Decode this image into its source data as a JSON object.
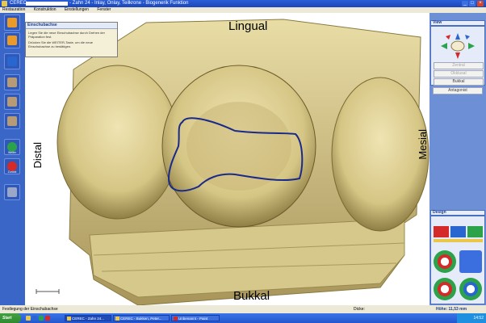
{
  "window": {
    "app_name": "CEREC",
    "title_rest": "- Zahn 24 - Inlay, Onlay, Teilkrone - Biogenerik Funktion"
  },
  "menu": [
    "Restauration",
    "Konstruktion",
    "Einstellungen",
    "Fenster"
  ],
  "toolbar": {
    "buttons": [
      {
        "name": "new-button",
        "label": "",
        "color": "#e89a2a"
      },
      {
        "name": "save-button",
        "label": "",
        "color": "#2a66d0"
      },
      {
        "name": "tool-1-button",
        "label": "",
        "color": "#b79b76"
      },
      {
        "name": "tool-2-button",
        "label": "",
        "color": "#b79b76"
      },
      {
        "name": "tool-3-button",
        "label": "",
        "color": "#b79b76"
      },
      {
        "name": "next-button",
        "label": "Weiter",
        "color": "#2ca24a"
      },
      {
        "name": "back-button",
        "label": "Zurück",
        "color": "#d42a2a"
      },
      {
        "name": "tool-4-button",
        "label": "",
        "color": "#9aa7c9"
      }
    ]
  },
  "tooltip": {
    "title": "Einschubachse",
    "line1": "Legen Sie die neue Einschubachse durch Drehen der Präparation fest.",
    "line2": "Drücken Sie die WEITER-Taste, um die neue Einschubachse zu bestätigen."
  },
  "labels": {
    "top": "Lingual",
    "left": "Distal",
    "right": "Mesial",
    "bottom": "Bukkal"
  },
  "view_panel": {
    "title": "View",
    "buttons": [
      "Zentral",
      "Okklusal",
      "Bukkal",
      "Antagonist"
    ],
    "disabled": [
      true,
      true,
      false,
      false
    ]
  },
  "design_panel": {
    "title": "Design"
  },
  "status": {
    "left": "Festlegung der Einschubachse",
    "mid": "Dicke:",
    "right": "Höhe: 11,53 mm"
  },
  "taskbar": {
    "start": "Start",
    "tasks": [
      "CEREC - Zahn 24...",
      "CEREC - Bukken, Peter...",
      "Unbenannt - Paint"
    ],
    "clock": "14:52"
  },
  "colors": {
    "tooth": "#e6d9a0",
    "margin_line": "#1a2a8a",
    "accent": "#3a66c8"
  }
}
